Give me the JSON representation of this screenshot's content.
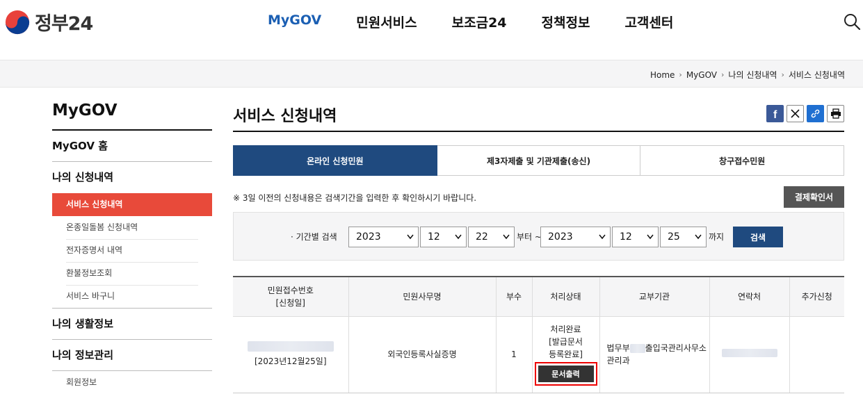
{
  "header": {
    "logo_text": "정부24",
    "nav": [
      "MyGOV",
      "민원서비스",
      "보조금24",
      "정책정보",
      "고객센터"
    ],
    "active_nav": "MyGOV",
    "colors": {
      "accent": "#1b5fb3",
      "primary": "#1f4a7f",
      "side_active": "#e84a3a"
    }
  },
  "breadcrumb": [
    "Home",
    "MyGOV",
    "나의 신청내역",
    "서비스 신청내역"
  ],
  "sidebar": {
    "title": "MyGOV",
    "home": "MyGOV 홈",
    "apply_group": "나의 신청내역",
    "apply_items": [
      "서비스 신청내역",
      "온종일돌봄 신청내역",
      "전자증명서 내역",
      "환불정보조회",
      "서비스 바구니"
    ],
    "life_group": "나의 생활정보",
    "info_group": "나의 정보관리",
    "info_items": [
      "회원정보"
    ]
  },
  "main": {
    "title": "서비스 신청내역",
    "share_icons": [
      "facebook-icon",
      "x-icon",
      "link-icon",
      "print-icon"
    ],
    "tabs": [
      "온라인 신청민원",
      "제3자제출 및 기관제출(송신)",
      "창구접수민원"
    ],
    "notice": "※ 3일 이전의 신청내용은 검색기간을 입력한 후 확인하시기 바랍니다.",
    "pay_button": "결제확인서",
    "search": {
      "label": "기간별 검색",
      "from_year": "2023",
      "from_month": "12",
      "from_day": "22",
      "from_word": "부터 ~",
      "to_year": "2023",
      "to_month": "12",
      "to_day": "25",
      "to_word": "까지",
      "button": "검색"
    },
    "table": {
      "headers": [
        "민원접수번호",
        "[신청일]",
        "민원사무명",
        "부수",
        "처리상태",
        "교부기관",
        "연락처",
        "추가신청"
      ],
      "row": {
        "date": "[2023년12월25일]",
        "name": "외국인등록사실증명",
        "count": "1",
        "status1": "처리완료",
        "status2": "[발급문서",
        "status3": "등록완료]",
        "print_button": "문서출력",
        "agency_pre": "법무부",
        "agency_post": "출입국관리사무소",
        "agency_line2": "관리과"
      }
    }
  }
}
